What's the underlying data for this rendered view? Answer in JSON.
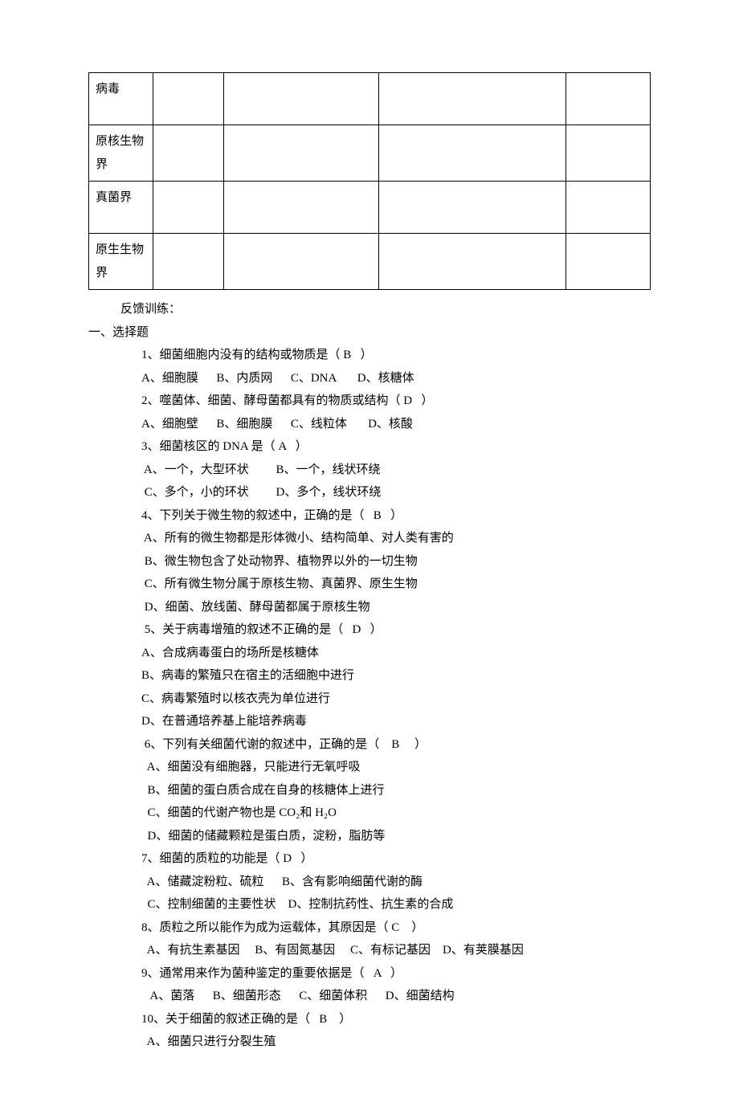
{
  "table_rows": [
    {
      "label": "病毒",
      "height": "tall"
    },
    {
      "label": "原核生物界",
      "height": "tall"
    },
    {
      "label": "真菌界",
      "height": "tall"
    },
    {
      "label": "原生生物界",
      "height": "short"
    }
  ],
  "section_feedback": "反馈训练：",
  "section_choice": "一、选择题",
  "questions": [
    {
      "stem": "1、细菌细胞内没有的结构或物质是（ B   ）",
      "opts": [
        "A、细胞膜      B、内质网      C、DNA       D、核糖体"
      ],
      "optsIndent": "indent2"
    },
    {
      "stem": "2、噬菌体、细菌、酵母菌都具有的物质或结构（ D   ）",
      "opts": [
        "A、细胞壁      B、细胞膜      C、线粒体       D、核酸"
      ],
      "optsIndent": "indent2"
    },
    {
      "stem": "3、细菌核区的 DNA 是（ A   ）",
      "opts": [
        " A、一个，大型环状         B、一个，线状环绕",
        " C、多个，小的环状         D、多个，线状环绕"
      ],
      "optsIndent": "indent2"
    },
    {
      "stem": "4、下列关于微生物的叙述中，正确的是（   B   ）",
      "opts": [
        " A、所有的微生物都是形体微小、结构简单、对人类有害的",
        " B、微生物包含了处动物界、植物界以外的一切生物",
        " C、所有微生物分属于原核生物、真菌界、原生生物",
        " D、细菌、放线菌、酵母菌都属于原核生物"
      ],
      "optsIndent": "indent2"
    },
    {
      "stem": " 5、关于病毒增殖的叙述不正确的是（   D   ）",
      "opts": [
        "A、合成病毒蛋白的场所是核糖体",
        "B、病毒的繁殖只在宿主的活细胞中进行",
        "C、病毒繁殖时以核衣壳为单位进行",
        "D、在普通培养基上能培养病毒"
      ],
      "optsIndent": "indent2"
    },
    {
      "stem": " 6、下列有关细菌代谢的叙述中，正确的是（    B     ）",
      "opts": [
        "  A、细菌没有细胞器，只能进行无氧呼吸",
        "  B、细菌的蛋白质合成在自身的核糖体上进行",
        "  C、细菌的代谢产物也是 CO₂和 H₂O",
        "  D、细菌的储藏颗粒是蛋白质，淀粉，脂肪等"
      ],
      "optsIndent": "indent2"
    },
    {
      "stem": "7、细菌的质粒的功能是（ D   ）",
      "opts": [
        "  A、储藏淀粉粒、硫粒      B、含有影响细菌代谢的酶",
        "  C、控制细菌的主要性状    D、控制抗药性、抗生素的合成"
      ],
      "optsIndent": "indent2"
    },
    {
      "stem": "8、质粒之所以能作为成为运载体，其原因是（ C    ）",
      "opts": [
        "  A、有抗生素基因     B、有固氮基因     C、有标记基因    D、有荚膜基因"
      ],
      "optsIndent": "indent2"
    },
    {
      "stem": "9、通常用来作为菌种鉴定的重要依据是（   A   ）",
      "opts": [
        "   A、菌落      B、细菌形态      C、细菌体积      D、细菌结构"
      ],
      "optsIndent": "indent2"
    },
    {
      "stem": "10、关于细菌的叙述正确的是（   B    ）",
      "opts": [
        "  A、细菌只进行分裂生殖"
      ],
      "optsIndent": "indent2"
    }
  ]
}
